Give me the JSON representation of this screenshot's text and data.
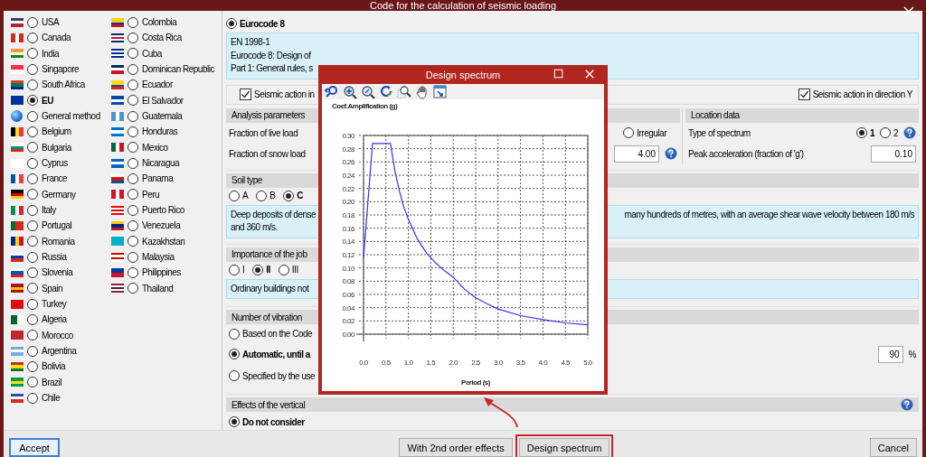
{
  "window": {
    "title": "Code for the calculation of seismic loading"
  },
  "country_columns": [
    {
      "items": [
        {
          "label": "USA",
          "selected": false
        },
        {
          "label": "Canada",
          "selected": false
        },
        {
          "label": "India",
          "selected": false
        },
        {
          "label": "Singapore",
          "selected": false
        },
        {
          "label": "South Africa",
          "selected": false
        },
        {
          "label": "EU",
          "selected": true
        },
        {
          "label": "General method",
          "selected": false,
          "kind": "globe"
        },
        {
          "label": "Belgium",
          "selected": false
        },
        {
          "label": "Bulgaria",
          "selected": false
        },
        {
          "label": "Cyprus",
          "selected": false
        },
        {
          "label": "France",
          "selected": false
        },
        {
          "label": "Germany",
          "selected": false
        },
        {
          "label": "Italy",
          "selected": false
        },
        {
          "label": "Portugal",
          "selected": false
        },
        {
          "label": "Romania",
          "selected": false
        },
        {
          "label": "Russia",
          "selected": false
        },
        {
          "label": "Slovenia",
          "selected": false
        },
        {
          "label": "Spain",
          "selected": false
        },
        {
          "label": "Turkey",
          "selected": false
        },
        {
          "label": "Algeria",
          "selected": false
        },
        {
          "label": "Morocco",
          "selected": false
        },
        {
          "label": "Argentina",
          "selected": false
        },
        {
          "label": "Bolivia",
          "selected": false
        },
        {
          "label": "Brazil",
          "selected": false
        },
        {
          "label": "Chile",
          "selected": false
        }
      ]
    },
    {
      "items": [
        {
          "label": "Colombia",
          "selected": false
        },
        {
          "label": "Costa Rica",
          "selected": false
        },
        {
          "label": "Cuba",
          "selected": false
        },
        {
          "label": "Dominican Republic",
          "selected": false
        },
        {
          "label": "Ecuador",
          "selected": false
        },
        {
          "label": "El Salvador",
          "selected": false
        },
        {
          "label": "Guatemala",
          "selected": false
        },
        {
          "label": "Honduras",
          "selected": false
        },
        {
          "label": "Mexico",
          "selected": false
        },
        {
          "label": "Nicaragua",
          "selected": false
        },
        {
          "label": "Panama",
          "selected": false
        },
        {
          "label": "Peru",
          "selected": false
        },
        {
          "label": "Puerto Rico",
          "selected": false
        },
        {
          "label": "Venezuela",
          "selected": false
        },
        {
          "label": "Kazakhstan",
          "selected": false
        },
        {
          "label": "Malaysia",
          "selected": false
        },
        {
          "label": "Philippines",
          "selected": false
        },
        {
          "label": "Thailand",
          "selected": false
        }
      ]
    }
  ],
  "code": {
    "label": "Eurocode 8",
    "selected": true
  },
  "description": [
    "EN 1998-1",
    "Eurocode 8: Design of",
    "Part 1: General rules, s"
  ],
  "seismic_x": {
    "label": "Seismic action in",
    "checked": true
  },
  "seismic_y": {
    "label": "Seismic action in direction Y",
    "checked": true
  },
  "analysis": {
    "title": "Analysis parameters",
    "live_load_label": "Fraction of live load",
    "snow_load_label": "Fraction of snow load",
    "regularity_option": {
      "label": "Irregular",
      "selected": false
    },
    "behaviour_value": "4.00"
  },
  "location": {
    "title": "Location data",
    "spectrum_label": "Type of spectrum",
    "spectrum_options": [
      {
        "label": "1",
        "selected": true
      },
      {
        "label": "2",
        "selected": false
      }
    ],
    "peak_label": "Peak acceleration (fraction of 'g')",
    "peak_value": "0.10"
  },
  "soil": {
    "title": "Soil type",
    "options": [
      {
        "label": "A",
        "selected": false
      },
      {
        "label": "B",
        "selected": false
      },
      {
        "label": "C",
        "selected": true
      }
    ],
    "description_lines": [
      {
        "left": "Deep deposits of dense",
        "right": "many hundreds of metres, with an average shear wave velocity between 180 m/s"
      },
      {
        "left": "and 360 m/s."
      }
    ]
  },
  "importance": {
    "title": "Importance of the job",
    "options": [
      {
        "label": "I",
        "selected": false
      },
      {
        "label": "II",
        "selected": true
      },
      {
        "label": "III",
        "selected": false
      }
    ],
    "description": "Ordinary buildings not"
  },
  "modes": {
    "title": "Number of vibration",
    "options": [
      {
        "label": "Based on the Code",
        "selected": false
      },
      {
        "label": "Automatic, until a",
        "selected": true
      },
      {
        "label": "Specified by the use",
        "selected": false
      }
    ],
    "value": "90",
    "unit": "%"
  },
  "vertical": {
    "title": "Effects of the vertical",
    "options": [
      {
        "label": "Do not consider",
        "selected": true
      }
    ]
  },
  "buttons": [
    {
      "label": "Accept",
      "kind": "default"
    },
    {
      "label": "With 2nd order effects",
      "kind": "normal"
    },
    {
      "label": "Design spectrum",
      "kind": "highlighted"
    },
    {
      "label": "Cancel",
      "kind": "normal"
    }
  ],
  "spectrum_window": {
    "title": "Design spectrum",
    "chart_data": {
      "type": "line",
      "xlabel": "Period (s)",
      "ylabel": "Coef.Amplification (g)",
      "x": [
        0,
        0.2,
        0.6,
        0.7,
        0.8,
        0.9,
        1.0,
        1.2,
        1.4,
        1.6,
        1.8,
        2.0,
        2.25,
        2.5,
        2.75,
        3.0,
        3.5,
        4.0,
        4.5,
        5.0
      ],
      "series": [
        {
          "color": "#3333ff",
          "values": [
            0.115,
            0.288,
            0.288,
            0.246,
            0.216,
            0.192,
            0.173,
            0.144,
            0.123,
            0.108,
            0.096,
            0.086,
            0.068,
            0.055,
            0.046,
            0.038,
            0.028,
            0.022,
            0.017,
            0.014
          ]
        }
      ],
      "xlim": [
        0,
        5
      ],
      "ylim": [
        0,
        0.3
      ],
      "grid": true,
      "xticks": [
        {
          "value": 0,
          "label": "0.0"
        },
        {
          "value": 0.5,
          "label": "0.5"
        },
        {
          "value": 1,
          "label": "1.0"
        },
        {
          "value": 1.5,
          "label": "1.5"
        },
        {
          "value": 2,
          "label": "2.0"
        },
        {
          "value": 2.5,
          "label": "2.5"
        },
        {
          "value": 3,
          "label": "3.0"
        },
        {
          "value": 3.5,
          "label": "3.5"
        },
        {
          "value": 4,
          "label": "4.0"
        },
        {
          "value": 4.5,
          "label": "4.5"
        },
        {
          "value": 5,
          "label": "5.0"
        }
      ],
      "yticks": [
        {
          "value": 0,
          "label": "0.00"
        },
        {
          "value": 0.02,
          "label": "0.02"
        },
        {
          "value": 0.04,
          "label": "0.04"
        },
        {
          "value": 0.06,
          "label": "0.06"
        },
        {
          "value": 0.08,
          "label": "0.08"
        },
        {
          "value": 0.1,
          "label": "0.10"
        },
        {
          "value": 0.12,
          "label": "0.12"
        },
        {
          "value": 0.14,
          "label": "0.14"
        },
        {
          "value": 0.16,
          "label": "0.16"
        },
        {
          "value": 0.18,
          "label": "0.18"
        },
        {
          "value": 0.2,
          "label": "0.20"
        },
        {
          "value": 0.22,
          "label": "0.22"
        },
        {
          "value": 0.24,
          "label": "0.24"
        },
        {
          "value": 0.26,
          "label": "0.26"
        },
        {
          "value": 0.28,
          "label": "0.28"
        },
        {
          "value": 0.3,
          "label": "0.30"
        }
      ]
    }
  }
}
